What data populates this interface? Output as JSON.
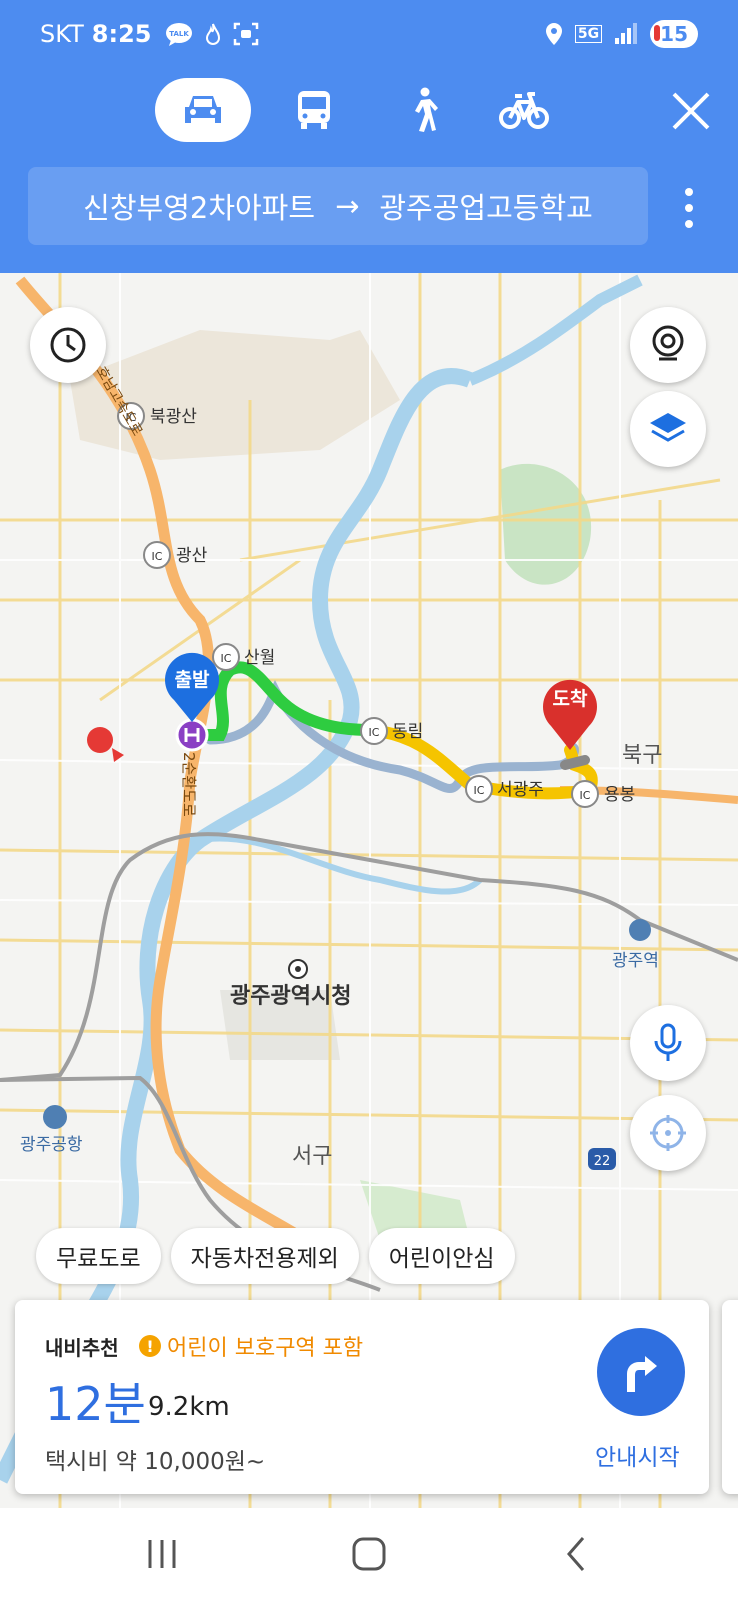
{
  "status_bar": {
    "carrier": "SKT",
    "time": "8:25",
    "talk": "TALK",
    "network": "5G",
    "battery": "15"
  },
  "transport_modes": [
    {
      "name": "car",
      "active": true
    },
    {
      "name": "bus",
      "active": false
    },
    {
      "name": "walk",
      "active": false
    },
    {
      "name": "bike",
      "active": false
    }
  ],
  "route": {
    "origin": "신창부영2차아파트",
    "arrow": "→",
    "destination": "광주공업고등학교"
  },
  "map": {
    "start_pin": "출발",
    "end_pin": "도착",
    "labels": {
      "bukgwangsan": "북광산",
      "gwangsan": "광산",
      "sanwol": "산월",
      "dongrim": "동림",
      "seogwangju": "서광주",
      "yongbong": "용봉",
      "bukgu": "북구",
      "gwangju_station": "광주역",
      "city_hall": "광주광역시청",
      "airport": "광주공항",
      "seogu": "서구",
      "ic": "IC",
      "route22": "22",
      "ring_road": "2순환도로",
      "honam": "호남고속도로"
    }
  },
  "filters": [
    "무료도로",
    "자동차전용제외",
    "어린이안심"
  ],
  "result": {
    "label": "내비추천",
    "warning": "어린이 보호구역 포함",
    "time": "12분",
    "distance": "9.2km",
    "taxi": "택시비 약 10,000원~",
    "start_label": "안내시작"
  },
  "colors": {
    "header_bg": "#4d8cf0",
    "accent": "#2f6fe0",
    "warning": "#f08a00",
    "route_green": "#2ecc40",
    "route_yellow": "#f5c400",
    "route_alt": "#9ab3d0"
  }
}
